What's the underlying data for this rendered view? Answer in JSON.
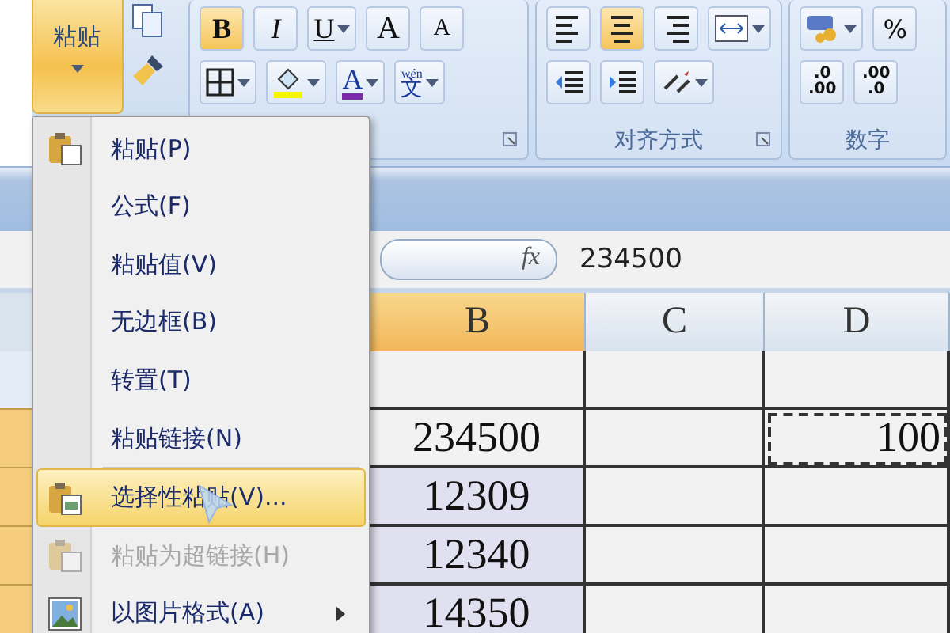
{
  "ribbon": {
    "clipboard": {
      "paste_label": "粘贴",
      "paste_dropdown": true
    },
    "font": {
      "row1": [
        {
          "kind": "bold",
          "label": "B",
          "selected": true,
          "dropdown": false
        },
        {
          "kind": "italic",
          "label": "I",
          "selected": false,
          "dropdown": false
        },
        {
          "kind": "underline",
          "label": "U",
          "selected": false,
          "dropdown": true
        },
        {
          "kind": "grow",
          "label": "A",
          "selected": false,
          "dropdown": false
        },
        {
          "kind": "shrink",
          "label": "A",
          "selected": false,
          "dropdown": false
        }
      ],
      "row2": [
        {
          "kind": "borders",
          "selected": false,
          "dropdown": true
        },
        {
          "kind": "fill",
          "selected": false,
          "dropdown": true
        },
        {
          "kind": "font-color",
          "label": "A",
          "selected": false,
          "dropdown": true
        },
        {
          "kind": "phonetic",
          "label": "文",
          "ruby": "wén",
          "selected": false,
          "dropdown": true
        }
      ]
    },
    "alignment": {
      "label": "对齐方式",
      "row1": [
        {
          "kind": "align-left",
          "selected": false,
          "dropdown": false
        },
        {
          "kind": "align-center",
          "selected": true,
          "dropdown": false
        },
        {
          "kind": "align-right",
          "selected": false,
          "dropdown": false
        },
        {
          "kind": "merge",
          "selected": false,
          "dropdown": true
        }
      ],
      "row2": [
        {
          "kind": "indent-less",
          "selected": false,
          "dropdown": false
        },
        {
          "kind": "indent-more",
          "selected": false,
          "dropdown": false
        },
        {
          "kind": "orientation",
          "selected": false,
          "dropdown": true
        }
      ]
    },
    "number": {
      "label": "数字",
      "row1": [
        {
          "kind": "currency",
          "selected": false,
          "dropdown": true
        },
        {
          "kind": "percent",
          "label": "%",
          "selected": false,
          "dropdown": false
        }
      ],
      "row2": [
        {
          "kind": "decimal",
          "label_top": ".0",
          "label_bottom": ".00",
          "selected": false,
          "dropdown": false
        },
        {
          "kind": "decimal",
          "label_top": ".00",
          "label_bottom": ".0",
          "selected": false,
          "dropdown": false
        }
      ]
    }
  },
  "formula_bar": {
    "fx_label": "fx",
    "value": "234500"
  },
  "sheet": {
    "columns": [
      {
        "label": "B",
        "selected": true
      },
      {
        "label": "C",
        "selected": false
      },
      {
        "label": "D",
        "selected": false
      }
    ],
    "rows": [
      {
        "selected": false,
        "cells": [
          {
            "text": "",
            "selected": false,
            "marquee": false
          },
          {
            "text": "",
            "selected": false,
            "marquee": false
          },
          {
            "text": "",
            "selected": false,
            "marquee": false
          }
        ]
      },
      {
        "selected": true,
        "cells": [
          {
            "text": "234500",
            "selected": false,
            "marquee": false
          },
          {
            "text": "",
            "selected": false,
            "marquee": false
          },
          {
            "text": "100",
            "selected": false,
            "marquee": true
          }
        ]
      },
      {
        "selected": true,
        "cells": [
          {
            "text": "12309",
            "selected": true,
            "marquee": false
          },
          {
            "text": "",
            "selected": false,
            "marquee": false
          },
          {
            "text": "",
            "selected": false,
            "marquee": false
          }
        ]
      },
      {
        "selected": true,
        "cells": [
          {
            "text": "12340",
            "selected": true,
            "marquee": false
          },
          {
            "text": "",
            "selected": false,
            "marquee": false
          },
          {
            "text": "",
            "selected": false,
            "marquee": false
          }
        ]
      },
      {
        "selected": true,
        "cells": [
          {
            "text": "14350",
            "selected": true,
            "marquee": false
          },
          {
            "text": "",
            "selected": false,
            "marquee": false
          },
          {
            "text": "",
            "selected": false,
            "marquee": false
          }
        ]
      }
    ]
  },
  "paste_menu": {
    "items": [
      {
        "kind": "paste",
        "label": "粘贴(P)",
        "selected": false,
        "disabled": false,
        "divider_before": false,
        "submenu": false
      },
      {
        "kind": "text",
        "label": "公式(F)",
        "selected": false,
        "disabled": false,
        "divider_before": false,
        "submenu": false
      },
      {
        "kind": "text",
        "label": "粘贴值(V)",
        "selected": false,
        "disabled": false,
        "divider_before": false,
        "submenu": false
      },
      {
        "kind": "text",
        "label": "无边框(B)",
        "selected": false,
        "disabled": false,
        "divider_before": false,
        "submenu": false
      },
      {
        "kind": "text",
        "label": "转置(T)",
        "selected": false,
        "disabled": false,
        "divider_before": false,
        "submenu": false
      },
      {
        "kind": "text",
        "label": "粘贴链接(N)",
        "selected": false,
        "disabled": false,
        "divider_before": false,
        "submenu": false
      },
      {
        "kind": "paste-special",
        "label": "选择性粘贴(V)...",
        "selected": true,
        "disabled": false,
        "divider_before": true,
        "submenu": false
      },
      {
        "kind": "paste-link",
        "label": "粘贴为超链接(H)",
        "selected": false,
        "disabled": true,
        "divider_before": false,
        "submenu": false
      },
      {
        "kind": "picture",
        "label": "以图片格式(A)",
        "selected": false,
        "disabled": false,
        "divider_before": false,
        "submenu": true
      }
    ]
  }
}
